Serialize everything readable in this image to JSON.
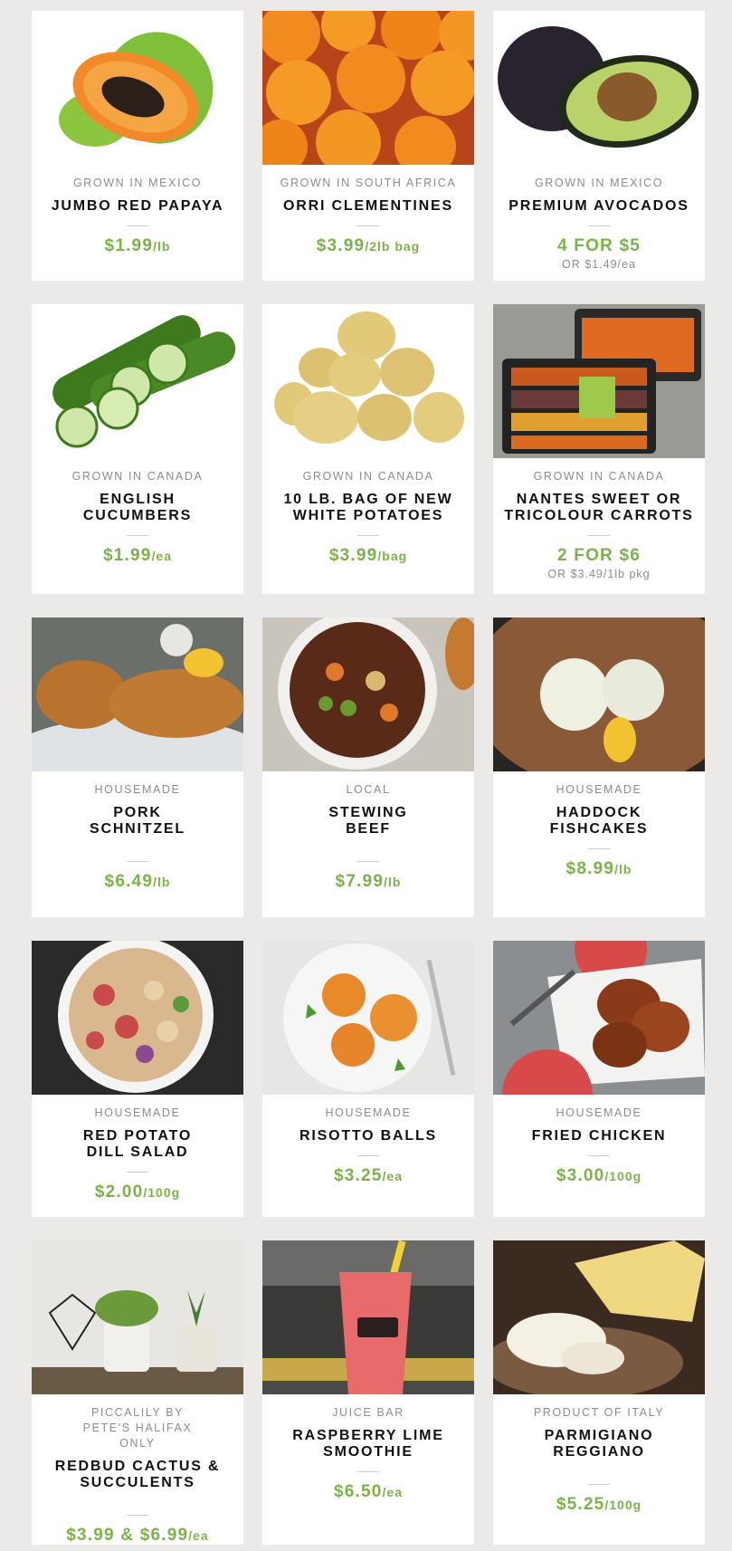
{
  "products": [
    {
      "origin": "GROWN IN MEXICO",
      "title": "JUMBO RED PAPAYA",
      "price": "$1.99",
      "unit": "/lb",
      "sub": ""
    },
    {
      "origin": "GROWN IN SOUTH AFRICA",
      "title": "ORRI CLEMENTINES",
      "price": "$3.99",
      "unit": "/2lb bag",
      "sub": ""
    },
    {
      "origin": "GROWN IN MEXICO",
      "title": "PREMIUM AVOCADOS",
      "price": "4 FOR $5",
      "unit": "",
      "sub": "OR $1.49/ea"
    },
    {
      "origin": "GROWN IN CANADA",
      "title": "ENGLISH CUCUMBERS",
      "price": "$1.99",
      "unit": "/ea",
      "sub": ""
    },
    {
      "origin": "GROWN IN CANADA",
      "title": "10 LB. BAG OF NEW WHITE POTATOES",
      "price": "$3.99",
      "unit": "/bag",
      "sub": ""
    },
    {
      "origin": "GROWN IN CANADA",
      "title": "NANTES SWEET OR TRICOLOUR CARROTS",
      "price": "2 FOR $6",
      "unit": "",
      "sub": "OR $3.49/1lb pkg"
    },
    {
      "origin": "HOUSEMADE",
      "title": "PORK SCHNITZEL",
      "price": "$6.49",
      "unit": "/lb",
      "sub": ""
    },
    {
      "origin": "LOCAL",
      "title": "STEWING BEEF",
      "price": "$7.99",
      "unit": "/lb",
      "sub": ""
    },
    {
      "origin": "HOUSEMADE",
      "title": "HADDOCK FISHCAKES",
      "price": "$8.99",
      "unit": "/lb",
      "sub": ""
    },
    {
      "origin": "HOUSEMADE",
      "title": "RED POTATO DILL SALAD",
      "price": "$2.00",
      "unit": "/100g",
      "sub": ""
    },
    {
      "origin": "HOUSEMADE",
      "title": "RISOTTO BALLS",
      "price": "$3.25",
      "unit": "/ea",
      "sub": ""
    },
    {
      "origin": "HOUSEMADE",
      "title": "FRIED CHICKEN",
      "price": "$3.00",
      "unit": "/100g",
      "sub": ""
    },
    {
      "origin": "PICCALILY BY PETE'S HALIFAX ONLY",
      "title": "REDBUD CACTUS & SUCCULENTS",
      "price": "$3.99 & $6.99",
      "unit": "/ea",
      "sub": ""
    },
    {
      "origin": "JUICE BAR",
      "title": "RASPBERRY LIME SMOOTHIE",
      "price": "$6.50",
      "unit": "/ea",
      "sub": ""
    },
    {
      "origin": "PRODUCT OF ITALY",
      "title": "PARMIGIANO REGGIANO",
      "price": "$5.25",
      "unit": "/100g",
      "sub": ""
    }
  ],
  "colors": {
    "price": "#7bb34a",
    "background": "#eceae8",
    "card": "#ffffff"
  }
}
